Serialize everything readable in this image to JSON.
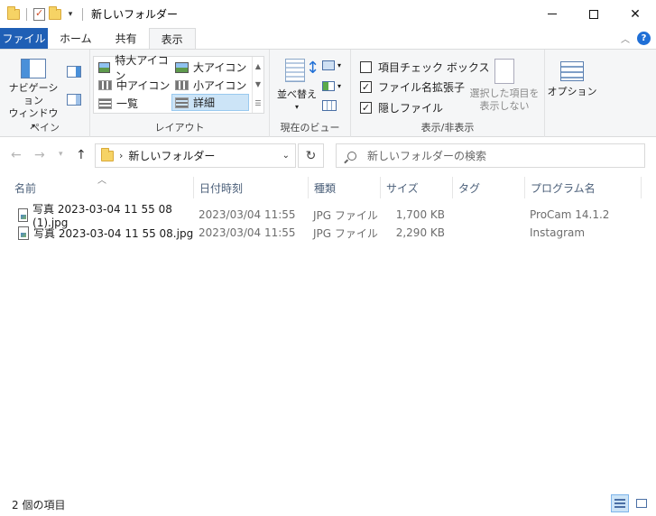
{
  "window": {
    "title": "新しいフォルダー",
    "buttons": {
      "minimize": "minimize",
      "maximize": "maximize",
      "close": "✕"
    }
  },
  "ribbon_tabs": {
    "file": "ファイル",
    "home": "ホーム",
    "share": "共有",
    "view": "表示",
    "help": "?"
  },
  "ribbon": {
    "pane": {
      "nav_pane_line1": "ナビゲーション",
      "nav_pane_line2": "ウィンドウ",
      "label": "ペイン"
    },
    "layout": {
      "items": [
        "特大アイコン",
        "大アイコン",
        "中アイコン",
        "小アイコン",
        "一覧",
        "詳細"
      ],
      "selected": "詳細",
      "label": "レイアウト"
    },
    "current_view": {
      "sort": "並べ替え",
      "label": "現在のビュー"
    },
    "show_hide": {
      "item_checkboxes": "項目チェック ボックス",
      "file_extensions": "ファイル名拡張子",
      "hidden_items": "隠しファイル",
      "hide_selected_line1": "選択した項目を",
      "hide_selected_line2": "表示しない",
      "label": "表示/非表示",
      "item_checkboxes_checked": false,
      "file_extensions_checked": true,
      "hidden_items_checked": true
    },
    "options": "オプション"
  },
  "navigation": {
    "path": "新しいフォルダー",
    "separator": "›",
    "search_placeholder": "新しいフォルダーの検索"
  },
  "columns": [
    "名前",
    "日付時刻",
    "種類",
    "サイズ",
    "タグ",
    "プログラム名"
  ],
  "files": [
    {
      "name": "写真 2023-03-04 11 55 08 (1).jpg",
      "date": "2023/03/04 11:55",
      "type": "JPG ファイル",
      "size": "1,700 KB",
      "tag": "",
      "program": "ProCam 14.1.2"
    },
    {
      "name": "写真 2023-03-04 11 55 08.jpg",
      "date": "2023/03/04 11:55",
      "type": "JPG ファイル",
      "size": "2,290 KB",
      "tag": "",
      "program": "Instagram"
    }
  ],
  "status": {
    "item_count": "2 個の項目"
  }
}
